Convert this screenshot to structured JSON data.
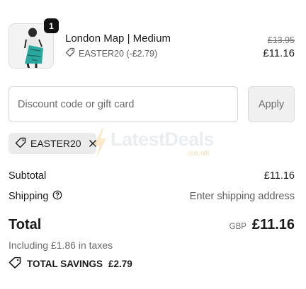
{
  "cart": {
    "item": {
      "name": "London Map | Medium",
      "quantity": "1",
      "discount_label": "EASTER20 (-£2.79)",
      "original_price": "£13.95",
      "price": "£11.16"
    }
  },
  "discount": {
    "placeholder": "Discount code or gift card",
    "value": "",
    "apply_label": "Apply",
    "applied_code": "EASTER20"
  },
  "watermark": {
    "title": "LatestDeals",
    "subtitle": ".co.uk"
  },
  "summary": {
    "subtotal_label": "Subtotal",
    "subtotal_value": "£11.16",
    "shipping_label": "Shipping",
    "shipping_value": "Enter shipping address",
    "total_label": "Total",
    "currency": "GBP",
    "total_value": "£11.16",
    "taxes_text": "Including £1.86 in taxes",
    "savings_label": "TOTAL SAVINGS",
    "savings_value": "£2.79"
  },
  "colors": {
    "text": "#1a1a1a",
    "muted": "#6b6b6b",
    "chip_bg": "#ebebeb",
    "badge_bg": "#111111"
  },
  "icons": [
    "tag-icon",
    "close-icon",
    "help-circle-icon",
    "savings-tag-icon"
  ]
}
